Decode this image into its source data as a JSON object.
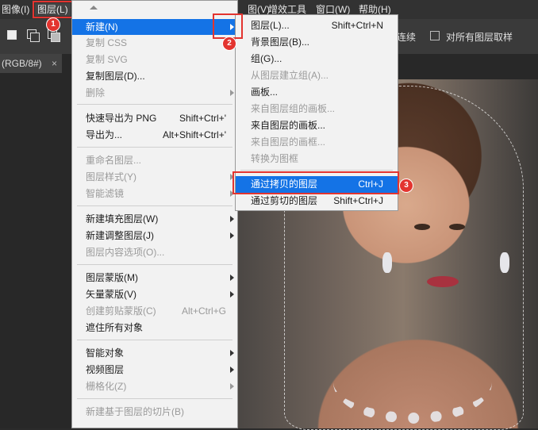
{
  "menubar": {
    "items": [
      {
        "label": "图像(I)"
      },
      {
        "label": "图层(L)"
      },
      {
        "label": "图(V)"
      },
      {
        "label": "增效工具"
      },
      {
        "label": "窗口(W)"
      },
      {
        "label": "帮助(H)"
      }
    ]
  },
  "options": {
    "continuous": "连续",
    "sample_all_layers": "对所有图层取样"
  },
  "document_tab": {
    "title": "(RGB/8#)",
    "close": "×"
  },
  "layer_menu": {
    "items": [
      {
        "label": "新建(N)",
        "shortcut": "",
        "disabled": false,
        "submenu": true,
        "highlighted": true
      },
      {
        "label": "复制 CSS",
        "shortcut": "",
        "disabled": true
      },
      {
        "label": "复制 SVG",
        "shortcut": "",
        "disabled": true
      },
      {
        "label": "复制图层(D)...",
        "shortcut": "",
        "disabled": false
      },
      {
        "label": "删除",
        "shortcut": "",
        "disabled": true,
        "submenu": true
      },
      {
        "label": "快速导出为 PNG",
        "shortcut": "Shift+Ctrl+'",
        "disabled": false
      },
      {
        "label": "导出为...",
        "shortcut": "Alt+Shift+Ctrl+'",
        "disabled": false
      },
      {
        "label": "重命名图层...",
        "shortcut": "",
        "disabled": true
      },
      {
        "label": "图层样式(Y)",
        "shortcut": "",
        "disabled": true,
        "submenu": true
      },
      {
        "label": "智能滤镜",
        "shortcut": "",
        "disabled": true,
        "submenu": true
      },
      {
        "label": "新建填充图层(W)",
        "shortcut": "",
        "disabled": false,
        "submenu": true
      },
      {
        "label": "新建调整图层(J)",
        "shortcut": "",
        "disabled": false,
        "submenu": true
      },
      {
        "label": "图层内容选项(O)...",
        "shortcut": "",
        "disabled": true
      },
      {
        "label": "图层蒙版(M)",
        "shortcut": "",
        "disabled": false,
        "submenu": true
      },
      {
        "label": "矢量蒙版(V)",
        "shortcut": "",
        "disabled": false,
        "submenu": true
      },
      {
        "label": "创建剪贴蒙版(C)",
        "shortcut": "Alt+Ctrl+G",
        "disabled": true
      },
      {
        "label": "遮住所有对象",
        "shortcut": "",
        "disabled": false
      },
      {
        "label": "智能对象",
        "shortcut": "",
        "disabled": false,
        "submenu": true
      },
      {
        "label": "视频图层",
        "shortcut": "",
        "disabled": false,
        "submenu": true
      },
      {
        "label": "栅格化(Z)",
        "shortcut": "",
        "disabled": true,
        "submenu": true
      },
      {
        "label": "新建基于图层的切片(B)",
        "shortcut": "",
        "disabled": true
      }
    ]
  },
  "new_submenu": {
    "items": [
      {
        "label": "图层(L)...",
        "shortcut": "Shift+Ctrl+N",
        "disabled": false
      },
      {
        "label": "背景图层(B)...",
        "shortcut": "",
        "disabled": false
      },
      {
        "label": "组(G)...",
        "shortcut": "",
        "disabled": false
      },
      {
        "label": "从图层建立组(A)...",
        "shortcut": "",
        "disabled": true
      },
      {
        "label": "画板...",
        "shortcut": "",
        "disabled": false
      },
      {
        "label": "来自图层组的画板...",
        "shortcut": "",
        "disabled": true
      },
      {
        "label": "来自图层的画板...",
        "shortcut": "",
        "disabled": false
      },
      {
        "label": "来自图层的画框...",
        "shortcut": "",
        "disabled": true
      },
      {
        "label": "转换为图框",
        "shortcut": "",
        "disabled": true
      },
      {
        "label": "通过拷贝的图层",
        "shortcut": "Ctrl+J",
        "disabled": false,
        "highlighted": true
      },
      {
        "label": "通过剪切的图层",
        "shortcut": "Shift+Ctrl+J",
        "disabled": false
      }
    ]
  },
  "annotations": {
    "step1": "1",
    "step2": "2",
    "step3": "3",
    "color": "#e3342f"
  }
}
